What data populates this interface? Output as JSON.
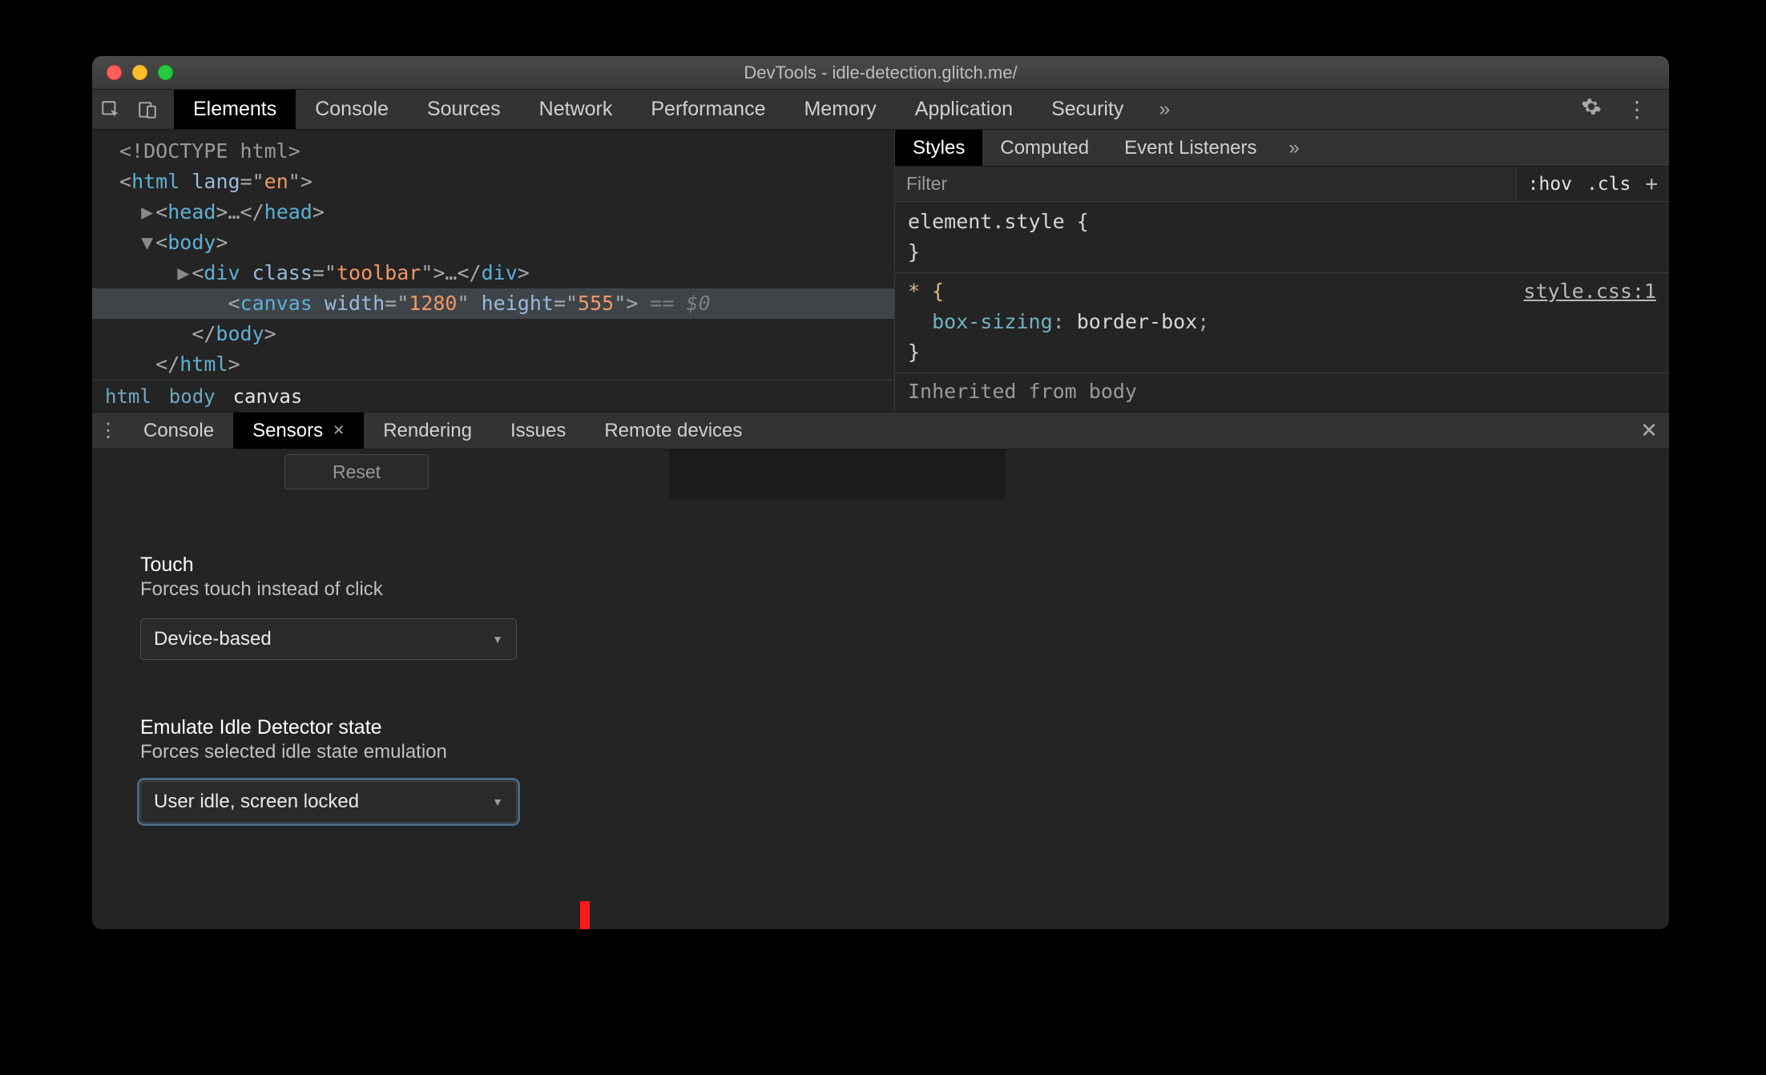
{
  "window": {
    "title": "DevTools - idle-detection.glitch.me/"
  },
  "tabs": {
    "items": [
      "Elements",
      "Console",
      "Sources",
      "Network",
      "Performance",
      "Memory",
      "Application",
      "Security"
    ],
    "activeIndex": 0,
    "overflow": "»"
  },
  "domTree": {
    "lines": [
      {
        "indent": 0,
        "html": "<span class='tk-doctype'>&lt;!DOCTYPE html&gt;</span>"
      },
      {
        "indent": 0,
        "html": "<span class='tk-punc'>&lt;</span><span class='tk-tag'>html</span> <span class='tk-attr'>lang</span><span class='tk-punc'>=\"</span><span class='tk-val'>en</span><span class='tk-punc'>\"&gt;</span>"
      },
      {
        "indent": 1,
        "tri": "▶",
        "html": "<span class='tk-punc'>&lt;</span><span class='tk-tag'>head</span><span class='tk-punc'>&gt;…&lt;/</span><span class='tk-tag'>head</span><span class='tk-punc'>&gt;</span>"
      },
      {
        "indent": 1,
        "tri": "▼",
        "html": "<span class='tk-punc'>&lt;</span><span class='tk-tag'>body</span><span class='tk-punc'>&gt;</span>"
      },
      {
        "indent": 2,
        "tri": "▶",
        "html": "<span class='tk-punc'>&lt;</span><span class='tk-tag'>div</span> <span class='tk-attr'>class</span><span class='tk-punc'>=\"</span><span class='tk-val'>toolbar</span><span class='tk-punc'>\"&gt;…&lt;/</span><span class='tk-tag'>div</span><span class='tk-punc'>&gt;</span>"
      },
      {
        "indent": 3,
        "selected": true,
        "html": "<span class='tk-punc'>&lt;</span><span class='tk-tag'>canvas</span> <span class='tk-attr'>width</span><span class='tk-punc'>=\"</span><span class='tk-val'>1280</span><span class='tk-punc'>\"</span> <span class='tk-attr'>height</span><span class='tk-punc'>=\"</span><span class='tk-val'>555</span><span class='tk-punc'>\"&gt;</span> <span class='tk-dim'>== $0</span>"
      },
      {
        "indent": 2,
        "html": "<span class='tk-punc'>&lt;/</span><span class='tk-tag'>body</span><span class='tk-punc'>&gt;</span>"
      },
      {
        "indent": 1,
        "html": "<span class='tk-punc'>&lt;/</span><span class='tk-tag'>html</span><span class='tk-punc'>&gt;</span>"
      }
    ]
  },
  "breadcrumb": {
    "items": [
      "html",
      "body",
      "canvas"
    ],
    "activeIndex": 2
  },
  "stylesTabs": {
    "items": [
      "Styles",
      "Computed",
      "Event Listeners"
    ],
    "activeIndex": 0,
    "overflow": "»"
  },
  "stylesFilter": {
    "placeholder": "Filter",
    "hov": ":hov",
    "cls": ".cls",
    "plus": "+"
  },
  "stylesBody": {
    "rule1": "element.style {\n}",
    "rule2_selector": "* {",
    "rule2_src": "style.css:1",
    "rule2_decl_prop": "box-sizing",
    "rule2_decl_val": "border-box",
    "rule2_close": "}",
    "inherited_prefix": "Inherited from ",
    "inherited_tag": "body"
  },
  "drawerTabs": {
    "items": [
      "Console",
      "Sensors",
      "Rendering",
      "Issues",
      "Remote devices"
    ],
    "activeIndex": 1
  },
  "resetLabel": "Reset",
  "touch": {
    "title": "Touch",
    "sub": "Forces touch instead of click",
    "value": "Device-based"
  },
  "idle": {
    "title": "Emulate Idle Detector state",
    "sub": "Forces selected idle state emulation",
    "value": "User idle, screen locked"
  },
  "annotation": {
    "arrowColor": "#ff1a1a"
  }
}
